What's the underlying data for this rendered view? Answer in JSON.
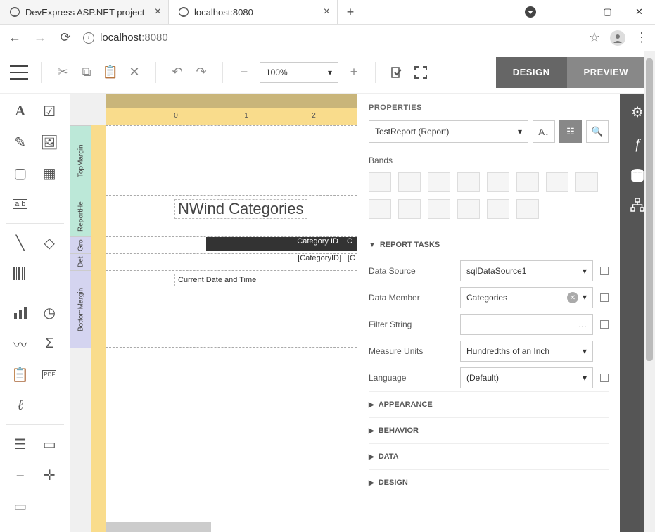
{
  "browser": {
    "tabs": [
      {
        "title": "DevExpress ASP.NET project"
      },
      {
        "title": "localhost:8080"
      }
    ],
    "url_display": "localhost:8080",
    "url_prefix": "localhost",
    "url_suffix": ":8080"
  },
  "toolbar": {
    "zoom": "100%",
    "design_label": "DESIGN",
    "preview_label": "PREVIEW"
  },
  "design_surface": {
    "ruler_marks": [
      "0",
      "1",
      "2"
    ],
    "bands": {
      "top_margin": "TopMargin",
      "report_header": "ReportHe",
      "group_header": "Gro",
      "detail": "Det",
      "bottom_margin": "BottomMargin"
    },
    "title": "NWind Categories",
    "column_headers": [
      "Category ID",
      "C"
    ],
    "detail_fields": [
      "[CategoryID]",
      "[C"
    ],
    "footer_text": "Current Date and Time"
  },
  "properties": {
    "panel_title": "PROPERTIES",
    "object_selector": "TestReport (Report)",
    "bands_label": "Bands",
    "sections": {
      "report_tasks": "REPORT TASKS",
      "appearance": "APPEARANCE",
      "behavior": "BEHAVIOR",
      "data": "DATA",
      "design": "DESIGN"
    },
    "fields": {
      "data_source": {
        "label": "Data Source",
        "value": "sqlDataSource1"
      },
      "data_member": {
        "label": "Data Member",
        "value": "Categories"
      },
      "filter_string": {
        "label": "Filter String",
        "value": ""
      },
      "measure_units": {
        "label": "Measure Units",
        "value": "Hundredths of an Inch"
      },
      "language": {
        "label": "Language",
        "value": "(Default)"
      }
    }
  }
}
